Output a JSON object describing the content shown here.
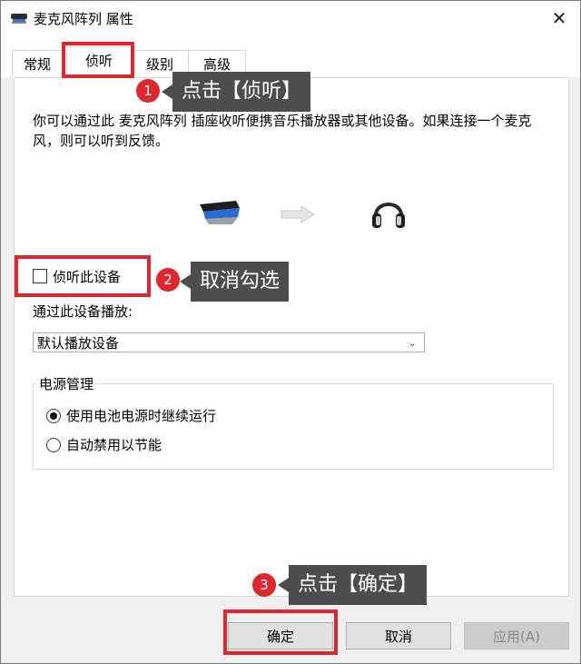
{
  "window": {
    "title": "麦克风阵列 属性",
    "close_symbol": "✕"
  },
  "tabs": [
    {
      "label": "常规",
      "active": false
    },
    {
      "label": "侦听",
      "active": true
    },
    {
      "label": "级别",
      "active": false
    },
    {
      "label": "高级",
      "active": false
    }
  ],
  "listen": {
    "description": "你可以通过此 麦克风阵列 插座收听便携音乐播放器或其他设备。如果连接一个麦克风，则可以听到反馈。",
    "checkbox_label": "侦听此设备",
    "checkbox_checked": false,
    "playback_label": "通过此设备播放:",
    "playback_value": "默认播放设备"
  },
  "power": {
    "legend": "电源管理",
    "options": [
      {
        "label": "使用电池电源时继续运行",
        "selected": true
      },
      {
        "label": "自动禁用以节能",
        "selected": false
      }
    ]
  },
  "buttons": {
    "ok": "确定",
    "cancel": "取消",
    "apply": "应用(A)"
  },
  "annotations": [
    {
      "number": "1",
      "text": "点击【侦听】"
    },
    {
      "number": "2",
      "text": "取消勾选"
    },
    {
      "number": "3",
      "text": "点击【确定】"
    }
  ],
  "colors": {
    "highlight_red": "#e0262d",
    "callout_gray": "#4d4d4d"
  }
}
